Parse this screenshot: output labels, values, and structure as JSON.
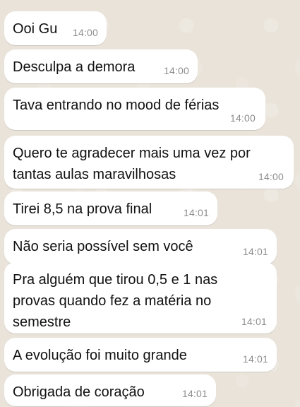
{
  "chat": {
    "messages": [
      {
        "text": "Ooi Gu",
        "time": "14:00"
      },
      {
        "text": "Desculpa a demora",
        "time": "14:00"
      },
      {
        "text": "Tava entrando no mood de férias",
        "time": "14:00"
      },
      {
        "text": "Quero te agradecer mais uma vez por\ntantas aulas maravilhosas",
        "time": "14:00"
      },
      {
        "text": "Tirei 8,5 na prova final",
        "time": "14:01"
      },
      {
        "text": "Não seria possível sem você",
        "time": "14:01"
      },
      {
        "text": "Pra alguém que tirou 0,5 e 1 nas\nprovas quando fez a matéria no\nsemestre",
        "time": "14:01"
      },
      {
        "text": "A evolução foi muito grande",
        "time": "14:01"
      },
      {
        "text": "Obrigada de coração",
        "time": "14:01"
      }
    ]
  }
}
